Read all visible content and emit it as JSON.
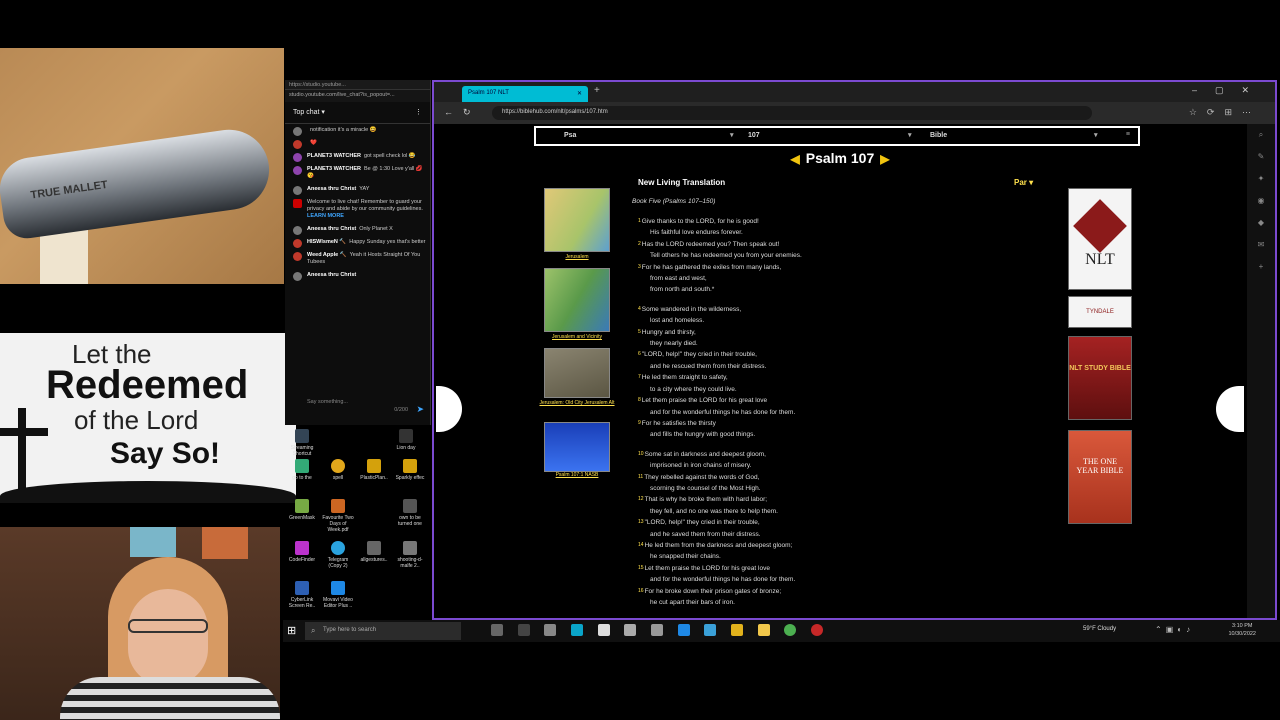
{
  "chat": {
    "browser_bar": "https://studio.youtube...",
    "url_bar": "studio.youtube.com/live_chat?is_popout=...",
    "mode_label": "Top chat",
    "messages": [
      {
        "author": "",
        "text": "notification it's a miracle 😆"
      },
      {
        "author": "",
        "text": "❤️"
      },
      {
        "author": "PLANET3 WATCHER",
        "text": "got spell check lol 😂"
      },
      {
        "author": "PLANET3 WATCHER",
        "text": "Be @ 1:30 Love y'all 💋 😘"
      },
      {
        "author": "Aneesa thru Christ",
        "text": "YAY"
      },
      {
        "author": "",
        "text": "Welcome to live chat! Remember to guard your privacy and abide by our community guidelines."
      },
      {
        "author": "Aneesa thru Christ",
        "text": "Only Planet X"
      },
      {
        "author": "HISWlsmeN 🔨",
        "text": "Happy Sunday yes that's better"
      },
      {
        "author": "Weed Apple 🔨",
        "text": "Yeah it Hosts Straight Of You Tubees"
      },
      {
        "author": "Aneesa thru Christ",
        "text": ""
      }
    ],
    "learn_more": "LEARN MORE",
    "input_placeholder": "Say something...",
    "char_count": "0/200"
  },
  "banner": {
    "line1": "Let the",
    "line2": "Redeemed",
    "line3": "of the Lord",
    "line4": "Say So!"
  },
  "camera_label": "TRUE MALLET",
  "desktop_icons": [
    {
      "label": "Streaming Shortcut"
    },
    {
      "label": "Lion day"
    },
    {
      "label": "go to the"
    },
    {
      "label": "spell"
    },
    {
      "label": "PlasticPlan.."
    },
    {
      "label": "Sparkly effec"
    },
    {
      "label": "GreenMask"
    },
    {
      "label": "Favourite Two Days of Week.pdf"
    },
    {
      "label": "own to be turned one"
    },
    {
      "label": "CodeFinder"
    },
    {
      "label": "Telegram (Copy 2)"
    },
    {
      "label": "allgestures.."
    },
    {
      "label": "shooting-d-malfe 2.."
    },
    {
      "label": "CyberLink Screen Re.."
    },
    {
      "label": "Movavi Video Editor Plus .."
    }
  ],
  "browser": {
    "tab_title": "Psalm 107 NLT",
    "url": "https://biblehub.com/nlt/psalms/107.htm"
  },
  "page": {
    "book_select": "Psa",
    "chapter_select": "107",
    "version_select": "Bible",
    "chapter_title": "Psalm 107",
    "translation": "New Living Translation",
    "parallel": "Par ▾",
    "book_heading": "Book Five (Psalms 107–150)",
    "verses": [
      {
        "num": "1",
        "text": "Give thanks to the LORD, for he is good!",
        "indent": false
      },
      {
        "num": "",
        "text": "His faithful love endures forever.",
        "indent": true
      },
      {
        "num": "2",
        "text": "Has the LORD redeemed you? Then speak out!",
        "indent": false
      },
      {
        "num": "",
        "text": "Tell others he has redeemed you from your enemies.",
        "indent": true
      },
      {
        "num": "3",
        "text": "For he has gathered the exiles from many lands,",
        "indent": false
      },
      {
        "num": "",
        "text": "from east and west,",
        "indent": true
      },
      {
        "num": "",
        "text": "from north and south.*",
        "indent": true
      },
      {
        "num": "",
        "text": "",
        "gap": true
      },
      {
        "num": "4",
        "text": "Some wandered in the wilderness,",
        "indent": false
      },
      {
        "num": "",
        "text": "lost and homeless.",
        "indent": true
      },
      {
        "num": "5",
        "text": "Hungry and thirsty,",
        "indent": false
      },
      {
        "num": "",
        "text": "they nearly died.",
        "indent": true
      },
      {
        "num": "6",
        "text": "\"LORD, help!\" they cried in their trouble,",
        "indent": false
      },
      {
        "num": "",
        "text": "and he rescued them from their distress.",
        "indent": true
      },
      {
        "num": "7",
        "text": "He led them straight to safety,",
        "indent": false
      },
      {
        "num": "",
        "text": "to a city where they could live.",
        "indent": true
      },
      {
        "num": "8",
        "text": "Let them praise the LORD for his great love",
        "indent": false
      },
      {
        "num": "",
        "text": "and for the wonderful things he has done for them.",
        "indent": true
      },
      {
        "num": "9",
        "text": "For he satisfies the thirsty",
        "indent": false
      },
      {
        "num": "",
        "text": "and fills the hungry with good things.",
        "indent": true
      },
      {
        "num": "",
        "text": "",
        "gap": true
      },
      {
        "num": "10",
        "text": "Some sat in darkness and deepest gloom,",
        "indent": false
      },
      {
        "num": "",
        "text": "imprisoned in iron chains of misery.",
        "indent": true
      },
      {
        "num": "11",
        "text": "They rebelled against the words of God,",
        "indent": false
      },
      {
        "num": "",
        "text": "scorning the counsel of the Most High.",
        "indent": true
      },
      {
        "num": "12",
        "text": "That is why he broke them with hard labor;",
        "indent": false
      },
      {
        "num": "",
        "text": "they fell, and no one was there to help them.",
        "indent": true
      },
      {
        "num": "13",
        "text": "\"LORD, help!\" they cried in their trouble,",
        "indent": false
      },
      {
        "num": "",
        "text": "and he saved them from their distress.",
        "indent": true
      },
      {
        "num": "14",
        "text": "He led them from the darkness and deepest gloom;",
        "indent": false
      },
      {
        "num": "",
        "text": "he snapped their chains.",
        "indent": true
      },
      {
        "num": "15",
        "text": "Let them praise the LORD for his great love",
        "indent": false
      },
      {
        "num": "",
        "text": "and for the wonderful things he has done for them.",
        "indent": true
      },
      {
        "num": "16",
        "text": "For he broke down their prison gates of bronze;",
        "indent": false
      },
      {
        "num": "",
        "text": "he cut apart their bars of iron.",
        "indent": true
      }
    ],
    "thumbnails": [
      {
        "caption": "Jerusalem",
        "color": "#c9b060"
      },
      {
        "caption": "Jerusalem and Vicinity",
        "color": "#6da85a"
      },
      {
        "caption": "Jerusalem: Old City Jerusalem Alt",
        "color": "#6e6650"
      },
      {
        "caption": "Psalm 107:1 NASB",
        "color": "#1e4fd8"
      }
    ],
    "ads": [
      {
        "label": "NLT",
        "bg": "#f4f4f4"
      },
      {
        "label": "TYNDALE",
        "bg": "#f4f4f4"
      },
      {
        "label": "NLT STUDY BIBLE",
        "bg": "#8b1a1a"
      },
      {
        "label": "THE ONE YEAR BIBLE",
        "bg": "#c8472e"
      }
    ]
  },
  "taskbar": {
    "search_placeholder": "Type here to search",
    "weather": "59°F Cloudy",
    "time": "3:10 PM",
    "date": "10/30/2022"
  }
}
